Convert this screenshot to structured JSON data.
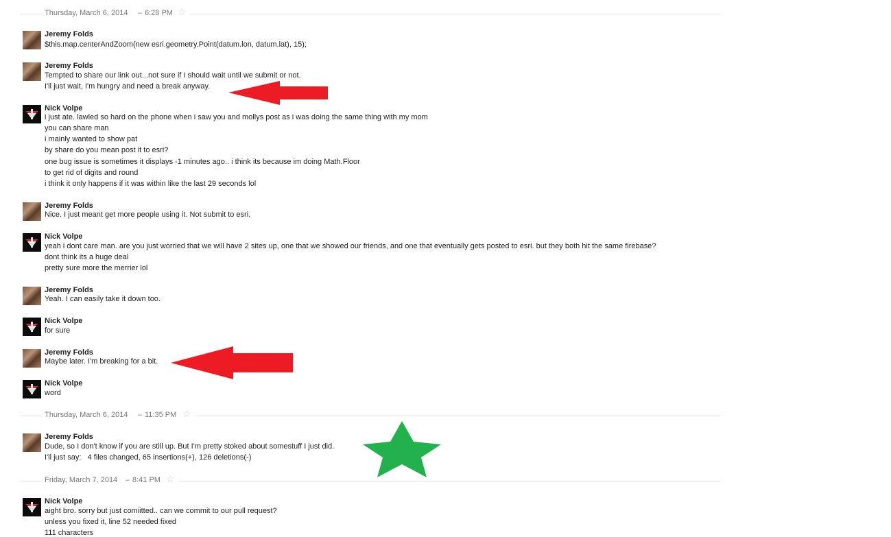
{
  "separators": [
    {
      "date": "Thursday, March 6, 2014",
      "time": "6:28 PM"
    },
    {
      "date": "Thursday, March 6, 2014",
      "time": "11:35 PM"
    },
    {
      "date": "Friday, March 7, 2014",
      "time": "8:41 PM"
    }
  ],
  "messages": [
    {
      "sender": "Jeremy Folds",
      "avatar": "jeremy",
      "lines": [
        "$this.map.centerAndZoom(new esri.geometry.Point(datum.lon, datum.lat), 15);"
      ]
    },
    {
      "sender": "Jeremy Folds",
      "avatar": "jeremy",
      "lines": [
        "Tempted to share our link out...not sure if I should wait until we submit or not.",
        "I'll just wait, I'm hungry and need a break anyway."
      ]
    },
    {
      "sender": "Nick Volpe",
      "avatar": "nick",
      "lines": [
        "i just ate. lawled so hard on the phone when i saw you and mollys post as i was doing the same thing with my mom",
        "you can share man",
        "i mainly wanted to show pat",
        "by share do you mean post it to esri?",
        "one bug issue is sometimes it displays -1 minutes ago.. i think its because im doing Math.Floor",
        "to get rid of digits and round",
        "i think it only happens if it was within like the last 29 seconds lol"
      ]
    },
    {
      "sender": "Jeremy Folds",
      "avatar": "jeremy",
      "lines": [
        "Nice. I just meant get more people using it. Not submit to esri."
      ]
    },
    {
      "sender": "Nick Volpe",
      "avatar": "nick",
      "lines": [
        "yeah i dont care man. are you just worried that we will have 2 sites up, one that we showed our friends, and one that eventually gets posted to esri. but they both hit the same firebase?",
        "dont think its a huge deal",
        "pretty sure more the merrier lol"
      ]
    },
    {
      "sender": "Jeremy Folds",
      "avatar": "jeremy",
      "lines": [
        "Yeah. I can easily take it down too."
      ]
    },
    {
      "sender": "Nick Volpe",
      "avatar": "nick",
      "lines": [
        "for sure"
      ]
    },
    {
      "sender": "Jeremy Folds",
      "avatar": "jeremy",
      "lines": [
        "Maybe later. I'm breaking for a bit."
      ]
    },
    {
      "sender": "Nick Volpe",
      "avatar": "nick",
      "lines": [
        "word"
      ]
    },
    {
      "sender": "Jeremy Folds",
      "avatar": "jeremy",
      "lines": [
        "Dude, so I don't know if you are still up. But I'm pretty stoked about somestuff I just did.",
        "I'll just say:   4 files changed, 65 insertions(+), 126 deletions(-)"
      ]
    },
    {
      "sender": "Nick Volpe",
      "avatar": "nick",
      "lines": [
        "aight bro. sorry but just comiitted.. can we commit to our pull request?",
        "unless you fixed it, line 52 needed fixed",
        "111 characters"
      ]
    }
  ],
  "annotations": {
    "arrow_color": "#ed1c24",
    "star_color": "#22b14c"
  },
  "colors": {
    "separator_text": "#777777",
    "separator_line": "#e2e2e2",
    "text": "#222222"
  }
}
